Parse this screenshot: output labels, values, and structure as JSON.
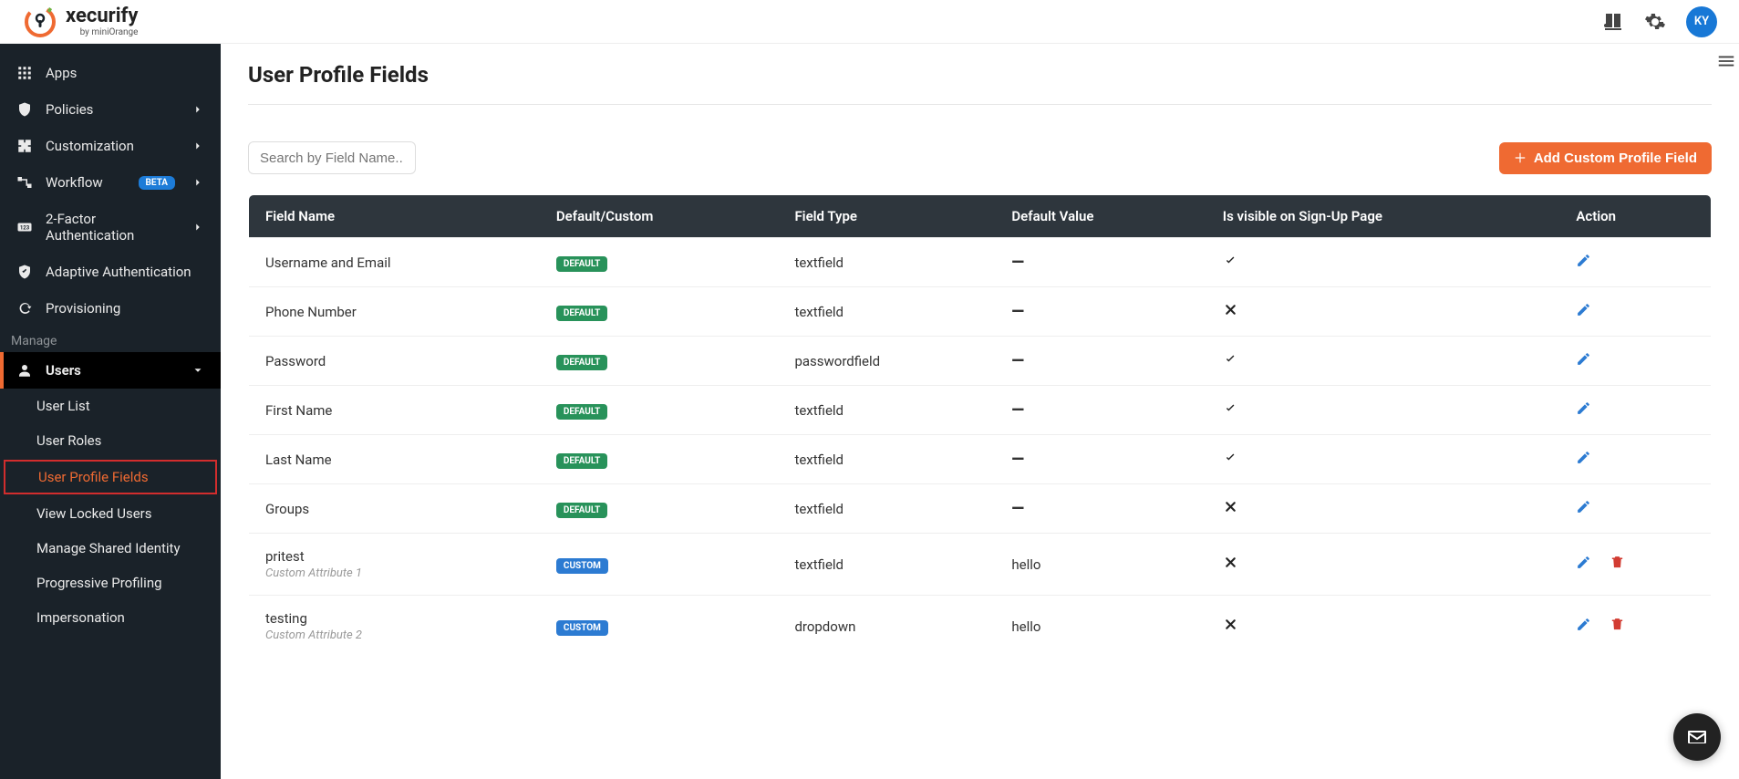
{
  "brand": {
    "name": "xecurify",
    "sub": "by miniOrange"
  },
  "avatar_initials": "KY",
  "sidebar": {
    "items": [
      {
        "label": "Apps"
      },
      {
        "label": "Policies"
      },
      {
        "label": "Customization"
      },
      {
        "label": "Workflow",
        "beta": "BETA"
      },
      {
        "label": "2-Factor Authentication"
      },
      {
        "label": "Adaptive Authentication"
      },
      {
        "label": "Provisioning"
      }
    ],
    "section_label": "Manage",
    "users_label": "Users",
    "subitems": [
      {
        "label": "User List"
      },
      {
        "label": "User Roles"
      },
      {
        "label": "User Profile Fields"
      },
      {
        "label": "View Locked Users"
      },
      {
        "label": "Manage Shared Identity"
      },
      {
        "label": "Progressive Profiling"
      },
      {
        "label": "Impersonation"
      }
    ]
  },
  "page": {
    "title": "User Profile Fields",
    "search_placeholder": "Search by Field Name...",
    "add_button": "Add Custom Profile Field"
  },
  "table": {
    "headers": [
      "Field Name",
      "Default/Custom",
      "Field Type",
      "Default Value",
      "Is visible on Sign-Up Page",
      "Action"
    ],
    "rows": [
      {
        "name": "Username and Email",
        "sub": "",
        "kind": "DEFAULT",
        "type": "textfield",
        "default": "—",
        "visible": true,
        "deletable": false
      },
      {
        "name": "Phone Number",
        "sub": "",
        "kind": "DEFAULT",
        "type": "textfield",
        "default": "—",
        "visible": false,
        "deletable": false
      },
      {
        "name": "Password",
        "sub": "",
        "kind": "DEFAULT",
        "type": "passwordfield",
        "default": "—",
        "visible": true,
        "deletable": false
      },
      {
        "name": "First Name",
        "sub": "",
        "kind": "DEFAULT",
        "type": "textfield",
        "default": "—",
        "visible": true,
        "deletable": false
      },
      {
        "name": "Last Name",
        "sub": "",
        "kind": "DEFAULT",
        "type": "textfield",
        "default": "—",
        "visible": true,
        "deletable": false
      },
      {
        "name": "Groups",
        "sub": "",
        "kind": "DEFAULT",
        "type": "textfield",
        "default": "—",
        "visible": false,
        "deletable": false
      },
      {
        "name": "pritest",
        "sub": "Custom Attribute 1",
        "kind": "CUSTOM",
        "type": "textfield",
        "default": "hello",
        "visible": false,
        "deletable": true
      },
      {
        "name": "testing",
        "sub": "Custom Attribute 2",
        "kind": "CUSTOM",
        "type": "dropdown",
        "default": "hello",
        "visible": false,
        "deletable": true
      }
    ]
  }
}
